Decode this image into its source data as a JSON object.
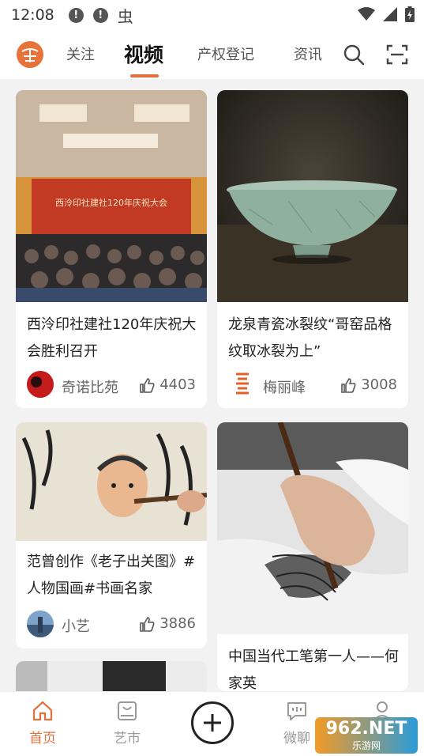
{
  "status_bar": {
    "time": "12:08",
    "notice_icons": [
      "!",
      "!"
    ],
    "bug_glyph": "虫"
  },
  "header": {
    "tabs": [
      {
        "label": "关注",
        "active": false
      },
      {
        "label": "视频",
        "active": true
      },
      {
        "label": "产权登记",
        "active": false
      },
      {
        "label": "资讯",
        "active": false
      }
    ],
    "accent_color": "#e2703a"
  },
  "feed": {
    "cards": [
      {
        "title": "西泠印社建社120年庆祝大会胜利召开",
        "banner_text": "西泠印社建社120年庆祝大会",
        "author": "奇诺比苑",
        "likes": "4403"
      },
      {
        "title": "龙泉青瓷冰裂纹“哥窑品格纹取冰裂为上”",
        "author": "梅丽峰",
        "likes": "3008"
      },
      {
        "title": "范曾创作《老子出关图》#人物国画#书画名家",
        "author": "小艺",
        "likes": "3886"
      },
      {
        "title": "中国当代工笔第一人——何家英"
      }
    ]
  },
  "bottom_nav": {
    "items": [
      {
        "label": "首页",
        "icon": "home-icon",
        "active": true
      },
      {
        "label": "艺市",
        "icon": "market-icon",
        "active": false
      },
      {
        "label": "",
        "icon": "plus-icon",
        "active": false
      },
      {
        "label": "微聊",
        "icon": "chat-icon",
        "active": false
      },
      {
        "label": "",
        "icon": "profile-icon",
        "active": false
      }
    ]
  },
  "watermark": {
    "main": "962.NET",
    "sub": "乐游网"
  }
}
